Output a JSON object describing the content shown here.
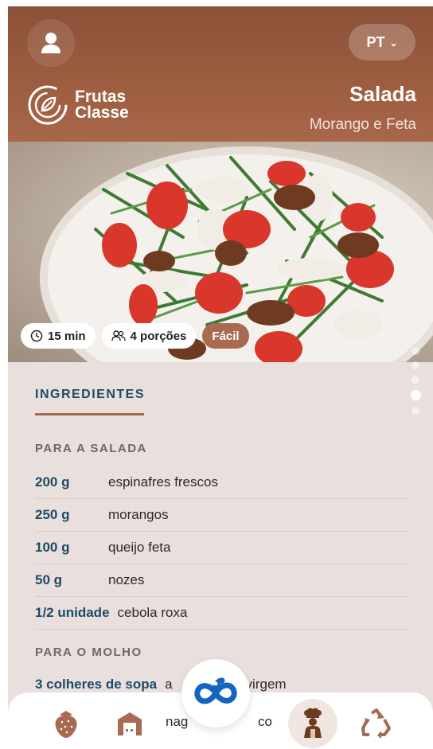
{
  "header": {
    "language": "PT",
    "brand": {
      "line1": "Frutas",
      "line2": "Classe"
    },
    "title": "Salada",
    "subtitle": "Morango e Feta"
  },
  "recipe_meta": {
    "time": "15 min",
    "servings": "4 porções",
    "difficulty": "Fácil"
  },
  "tabs": {
    "active_label": "INGREDIENTES"
  },
  "sections": [
    {
      "title": "PARA A SALADA",
      "items": [
        {
          "qty": "200 g",
          "name": "espinafres frescos"
        },
        {
          "qty": "250 g",
          "name": "morangos"
        },
        {
          "qty": "100 g",
          "name": "queijo feta"
        },
        {
          "qty": "50 g",
          "name": "nozes"
        },
        {
          "qty": "1/2 unidade",
          "name": "cebola roxa"
        }
      ]
    },
    {
      "title": "PARA O MOLHO",
      "items": [
        {
          "qty": "3 colheres de sopa",
          "name": "a",
          "name_tail": "virgem"
        }
      ]
    }
  ],
  "carousel": {
    "pages": 5,
    "active_index": 3
  },
  "nav": {
    "items": [
      "strawberry-icon",
      "store-icon",
      "chef-icon",
      "recycle-icon"
    ],
    "center": "logo-loop-icon",
    "partial_text": "nag",
    "partial_text2": "co"
  },
  "colors": {
    "header": "#9a5a3e",
    "accent": "#a86a50",
    "navy": "#1d4a66",
    "background": "#e9e0de",
    "link_blue": "#1565c0"
  }
}
